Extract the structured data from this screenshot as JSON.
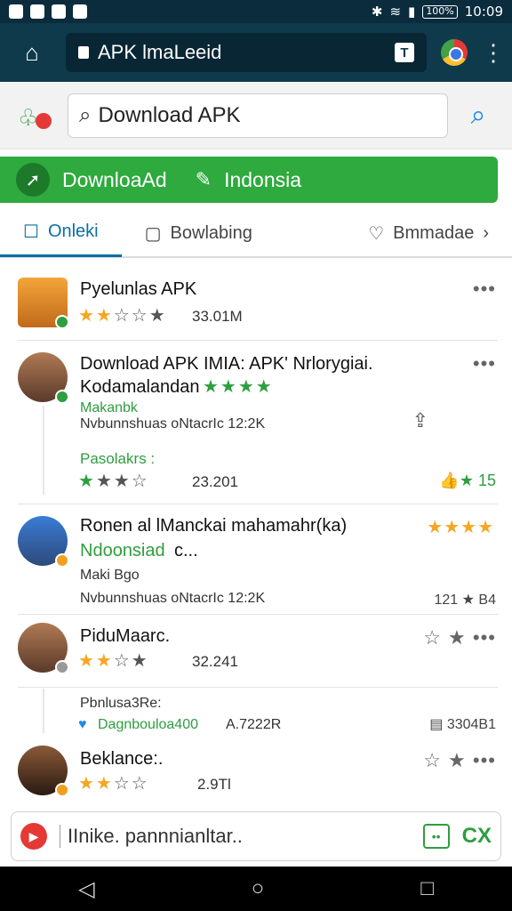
{
  "status": {
    "time": "10:09",
    "battery": "100%"
  },
  "browser": {
    "url": "APK lmaLeeid",
    "tab_count": "T",
    "menu_icon": "more-vert-icon"
  },
  "search": {
    "query": "Download APK",
    "icon": "search-icon"
  },
  "banner": {
    "label1": "DownloaAd",
    "label2": "Indonsia"
  },
  "tabs": [
    {
      "label": "Onleki"
    },
    {
      "label": "Bowlabing"
    },
    {
      "label": "Bmmadae"
    }
  ],
  "items": [
    {
      "title": "Pyelunlas APK",
      "count": "33.01M",
      "more": "•••"
    },
    {
      "title": "Download APK IMIA: APK' Nrlorygiai.",
      "title2": "Kodamalandan",
      "sub": "Makanbk",
      "meta": "Nvbunnshuas oNtacrIc 12:2K",
      "label": "Pasolakrs :",
      "count": "23.201",
      "right": "15",
      "more": "•••"
    },
    {
      "title": "Ronen al lManckai mahamahr(ka)",
      "title2": "Ndoonsiad",
      "title2_suffix": "c...",
      "sub": "Maki Bgo",
      "meta": "Nvbunnshuas oNtacrIc 12:2K",
      "right_meta": "121 ★ B4"
    },
    {
      "title": "PiduMaarc.",
      "count": "32.241",
      "more": "•••"
    },
    {
      "label": "Pbnlusa3Re:",
      "link": "Dagnbouloa400",
      "link_meta": "A.7222R",
      "right_meta": "3304B1"
    },
    {
      "title": "Beklance:.",
      "count": "2.9Tl",
      "more": "•••"
    }
  ],
  "bottom": {
    "placeholder": "IInike. pannnianltar..",
    "icon2": "CX"
  },
  "colors": {
    "accent": "#2eaa3e",
    "header": "#0e3a4c",
    "link": "#0b6fa4"
  }
}
